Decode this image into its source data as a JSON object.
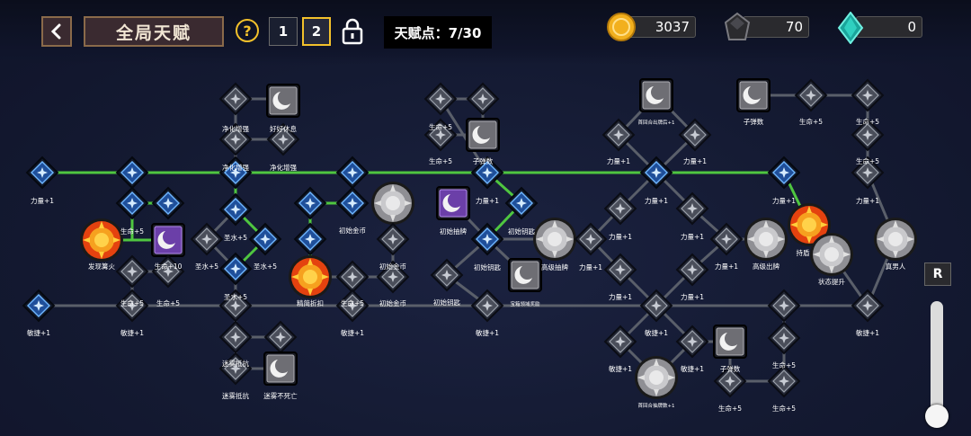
{
  "header": {
    "title": "全局天赋",
    "help": "?",
    "pages": [
      "1",
      "2"
    ],
    "active_page": "2",
    "talent_points": "天赋点：7/30"
  },
  "currencies": {
    "gold": "3037",
    "dark_gem": "70",
    "crystal": "0"
  },
  "controls": {
    "reset": "R"
  },
  "zoom_level": 0.1,
  "colors": {
    "active_link": "#4fc640",
    "inactive_link": "#5a5f6a",
    "gold_border": "#f3c12b",
    "panel_brown": "#3a2a30"
  },
  "tree": {
    "icon_types": [
      "blue-diamond-node",
      "gray-diamond-node",
      "moon-node",
      "sun-node",
      "silver-sun-node"
    ],
    "labels": {
      "a": "力量+1",
      "b": "生命+5",
      "c": "发现篝火",
      "d": "生命+10",
      "e": "敏捷+1",
      "f": "净化增强",
      "g": "好好休息",
      "h": "圣水+5",
      "i": "迷雾抵抗",
      "j": "迷雾不死亡",
      "k": "初始金币",
      "l": "精简折扣",
      "m": "生命+5",
      "n": "子弹数",
      "o": "力量+1",
      "p": "初始抽牌",
      "q": "初始钥匙",
      "r": "高级抽牌",
      "s": "宝箱领域奖励",
      "t": "力量+1",
      "u": "首回合出牌后+1",
      "v": "力量+1",
      "w": "力量+1",
      "x": "敏捷+1",
      "y": "敏捷+1",
      "z": "子弹数",
      "aa": "首回合抽牌数+1",
      "bb": "生命+5",
      "cc": "生命+5",
      "dd": "高级出牌",
      "ee": "持盾",
      "ff": "状态提升",
      "gg": "真男人",
      "hh": "生命+5",
      "ii": "敏捷+1",
      "jj": "子弹数",
      "kk": "生命+5",
      "ll": "生命+5",
      "mm": "力量+1",
      "nn": "净化增强",
      "oo": "初始金币",
      "pp": "初始钥匙",
      "qq": "敏捷+1",
      "rr": "敏捷+1",
      "ss": "迷雾抵抗"
    }
  }
}
